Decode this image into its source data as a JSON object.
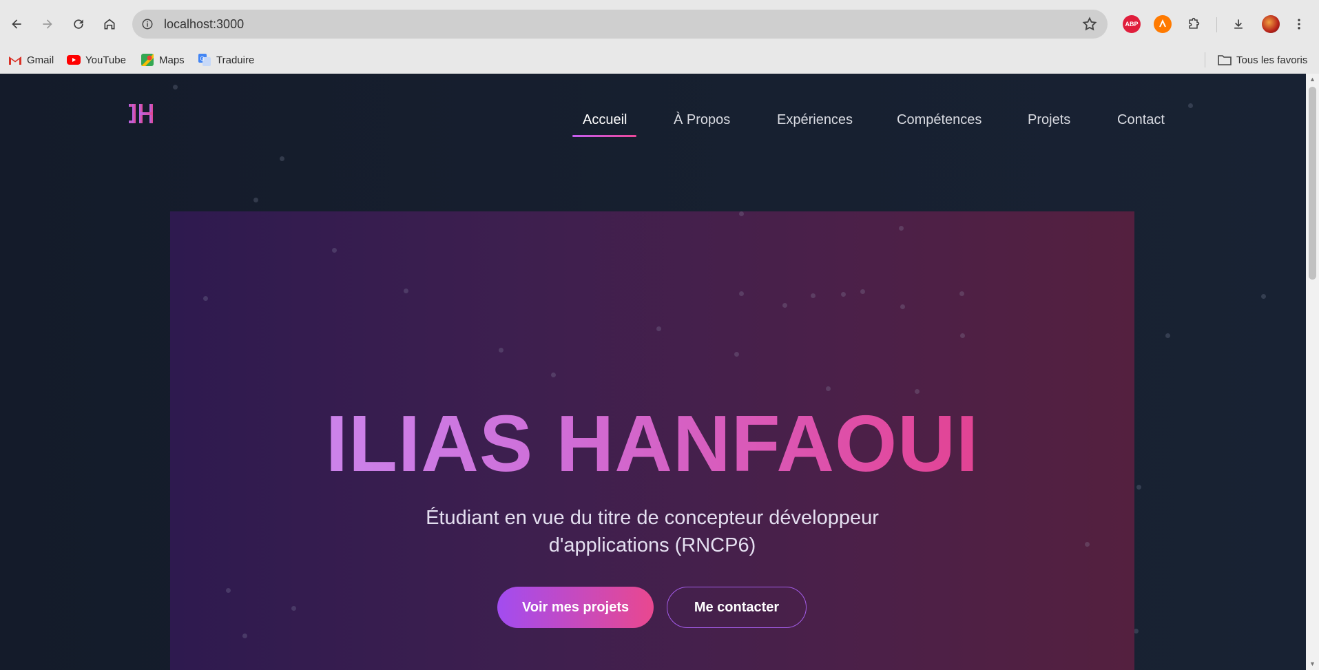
{
  "browser": {
    "url": "localhost:3000",
    "bookmarks": [
      {
        "label": "Gmail",
        "icon": "gmail-icon"
      },
      {
        "label": "YouTube",
        "icon": "youtube-icon"
      },
      {
        "label": "Maps",
        "icon": "maps-icon"
      },
      {
        "label": "Traduire",
        "icon": "translate-icon"
      }
    ],
    "all_bookmarks_label": "Tous les favoris",
    "extensions": [
      {
        "label": "ABP",
        "icon": "adblock-plus-icon",
        "color": "#e01e3c"
      },
      {
        "label": "",
        "icon": "avast-icon",
        "color": "#ff7a00"
      }
    ]
  },
  "site": {
    "logo_text": "IH",
    "nav": [
      {
        "label": "Accueil",
        "active": true
      },
      {
        "label": "À Propos",
        "active": false
      },
      {
        "label": "Expériences",
        "active": false
      },
      {
        "label": "Compétences",
        "active": false
      },
      {
        "label": "Projets",
        "active": false
      },
      {
        "label": "Contact",
        "active": false
      }
    ]
  },
  "hero": {
    "title": "ILIAS HANFAOUI",
    "subtitle_line1": "Étudiant en vue du titre de concepteur développeur",
    "subtitle_line2": "d'applications (RNCP6)",
    "primary_button": "Voir mes projets",
    "secondary_button": "Me contacter"
  },
  "colors": {
    "accent_purple": "#a24cf0",
    "accent_pink": "#e9488f",
    "page_background": "#17202f"
  }
}
